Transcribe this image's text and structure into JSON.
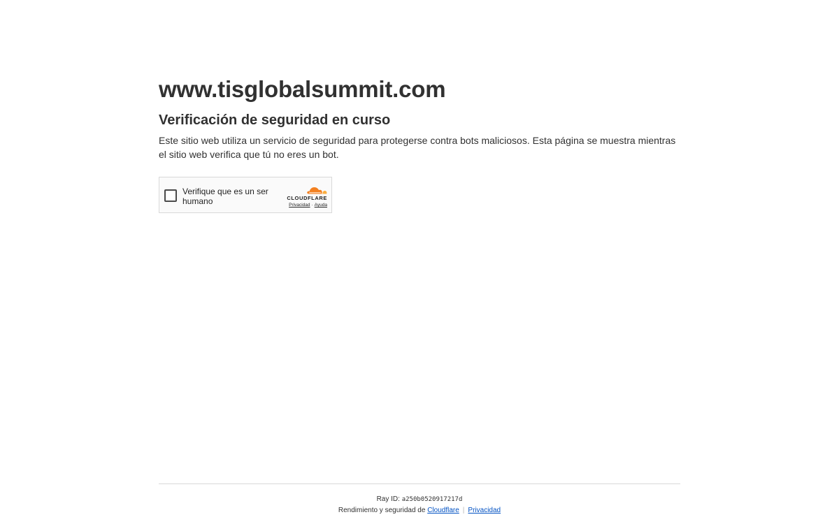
{
  "main": {
    "site_title": "www.tisglobalsummit.com",
    "subtitle": "Verificación de seguridad en curso",
    "description": "Este sitio web utiliza un servicio de seguridad para protegerse contra bots maliciosos. Esta página se muestra mientras el sitio web verifica que tú no eres un bot."
  },
  "widget": {
    "checkbox_label": "Verifique que es un ser humano",
    "brand_name": "CLOUDFLARE",
    "brand_icon": "cloudflare-cloud-icon",
    "privacy_link": "Privacidad",
    "help_link": "Ayuda",
    "separator": "·",
    "checked": false
  },
  "footer": {
    "ray_id_label": "Ray ID:",
    "ray_id_value": "a250b0520917217d",
    "performance_text": "Rendimiento y seguridad de",
    "cloudflare_link": "Cloudflare",
    "separator": "|",
    "privacy_link": "Privacidad"
  },
  "colors": {
    "text": "#313131",
    "link": "#0051c3",
    "cloudflare_orange": "#f38020",
    "cloudflare_light_orange": "#faae40",
    "widget_background": "#fafafa",
    "widget_border": "#d9d9d9"
  }
}
